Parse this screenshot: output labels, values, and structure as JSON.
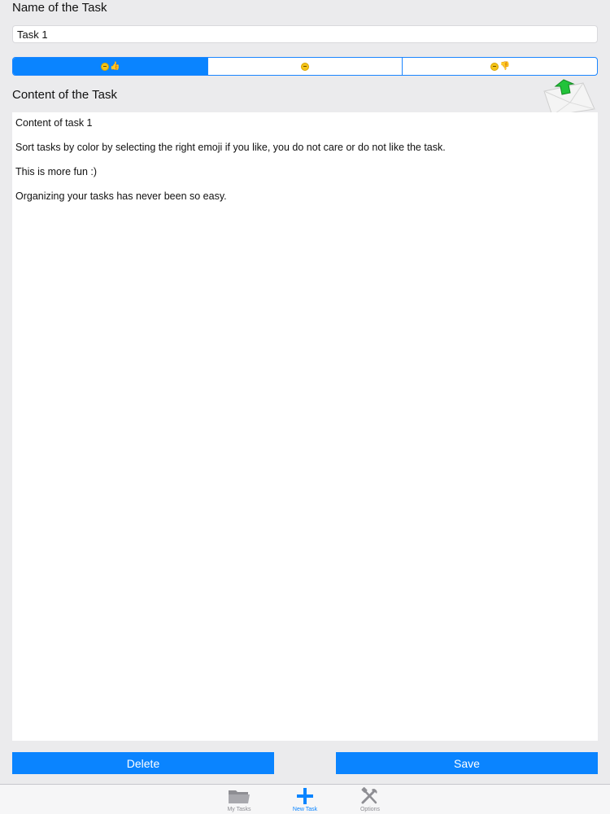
{
  "form": {
    "name_label": "Name of the Task",
    "name_value": "Task 1",
    "content_label": "Content of the Task",
    "content_lines": [
      "Content of task 1",
      "Sort tasks by color by selecting the right emoji if you like, you do not care or do not like the task.",
      "This is more fun :)",
      "Organizing your tasks has never been so easy."
    ]
  },
  "mood_selector": {
    "segments": [
      {
        "icon": "smiley-thumbs-up-emoji",
        "selected": true
      },
      {
        "icon": "neutral-face-emoji",
        "selected": false
      },
      {
        "icon": "unamused-thumbs-down-emoji",
        "selected": false
      }
    ]
  },
  "actions": {
    "delete_label": "Delete",
    "save_label": "Save"
  },
  "tabbar": {
    "tabs": [
      {
        "label": "My Tasks",
        "icon": "folder-icon",
        "active": false
      },
      {
        "label": "New Task",
        "icon": "plus-icon",
        "active": true
      },
      {
        "label": "Options",
        "icon": "tools-icon",
        "active": false
      }
    ]
  },
  "colors": {
    "accent": "#0a84ff",
    "background": "#ebebed",
    "envelope_arrow": "#22c33a"
  }
}
